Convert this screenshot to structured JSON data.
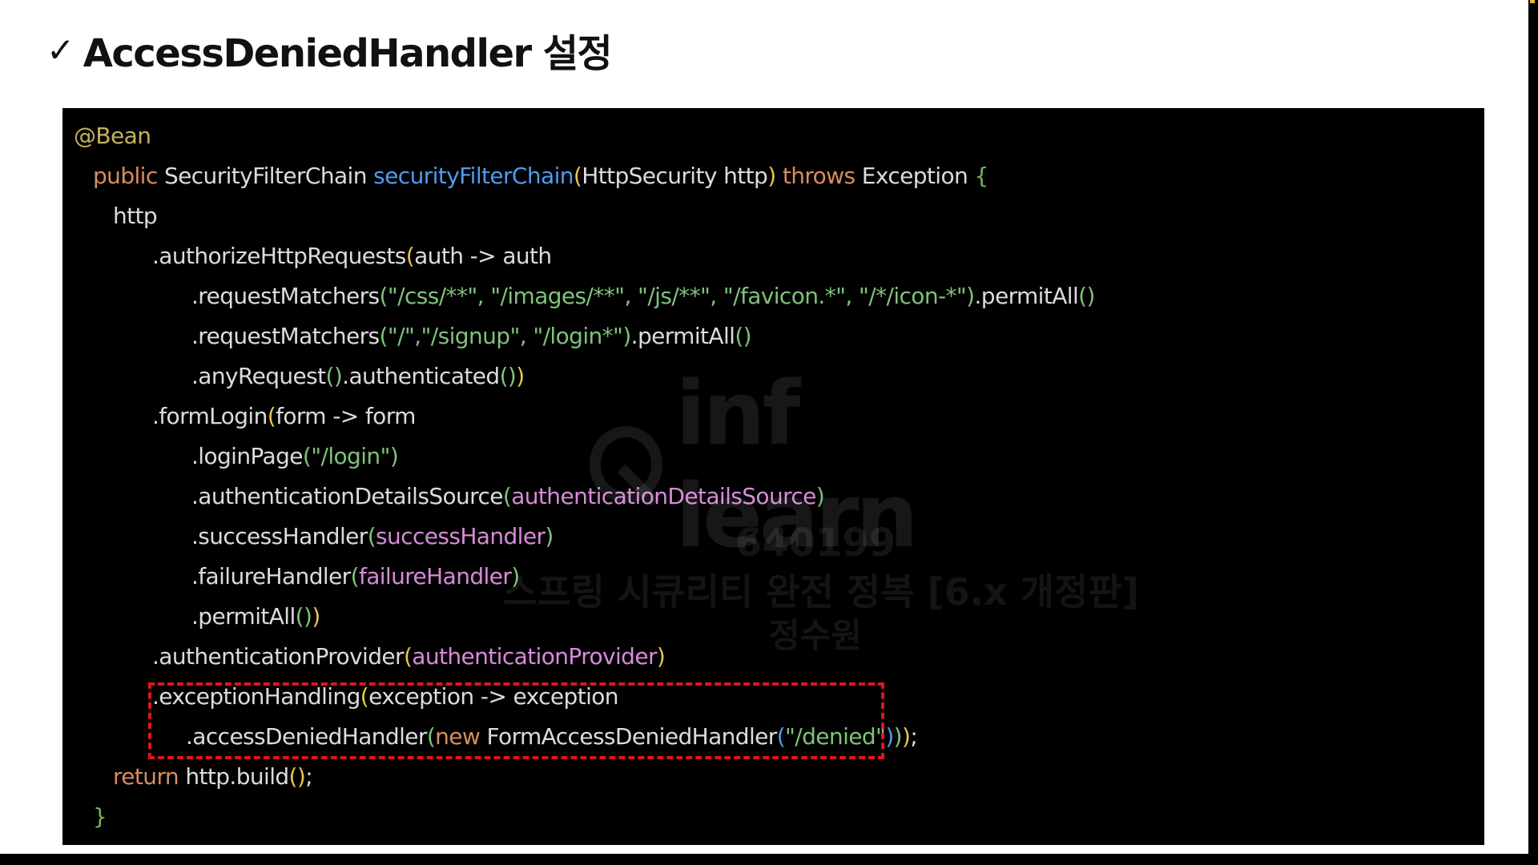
{
  "header": {
    "check_mark": "✓",
    "title": "AccessDeniedHandler 설정"
  },
  "code": {
    "annotation": "@Bean",
    "public_kw": "public",
    "return_type": " SecurityFilterChain ",
    "method_name": "securityFilterChain",
    "param": "HttpSecurity http",
    "throws_kw": "throws",
    "exception": " Exception ",
    "http": "http",
    "authorize": ".authorizeHttpRequests",
    "auth_lambda": "auth -> auth",
    "request_matchers": ".requestMatchers",
    "static_paths": "\"/css/**\", \"/images/**\", \"/js/**\", \"/favicon.*\", \"/*/icon-*\"",
    "permit_all": ".permitAll",
    "page_paths": "\"/\",\"/signup\", \"/login*\"",
    "any_request": ".anyRequest",
    "authenticated": ".authenticated",
    "form_login": ".formLogin",
    "form_lambda": "form -> form",
    "login_page": ".loginPage",
    "login_path": "\"/login\"",
    "details_source": ".authenticationDetailsSource",
    "details_source_arg": "authenticationDetailsSource",
    "success_handler": ".successHandler",
    "success_handler_arg": "successHandler",
    "failure_handler": ".failureHandler",
    "failure_handler_arg": "failureHandler",
    "auth_provider": ".authenticationProvider",
    "auth_provider_arg": "authenticationProvider",
    "exception_handling": ".exceptionHandling",
    "exception_lambda": "exception -> exception",
    "access_denied": ".accessDeniedHandler",
    "new_kw": "new",
    "handler_class": " FormAccessDeniedHandler",
    "denied_path": "\"/denied\"",
    "return_kw": "return",
    "build": " http.build",
    "close_brace": "}"
  },
  "watermark": {
    "logo_text": "inf learn",
    "id": "640199",
    "course": "스프링 시큐리티 완전 정복 [6.x 개정판]",
    "name": "정수원"
  },
  "colors": {
    "code_bg": "#000000",
    "keyword": "#d98c5f",
    "method": "#4f9cf0",
    "string": "#7fc27a",
    "variable": "#d78bd8",
    "highlight_border": "#e0141e"
  }
}
